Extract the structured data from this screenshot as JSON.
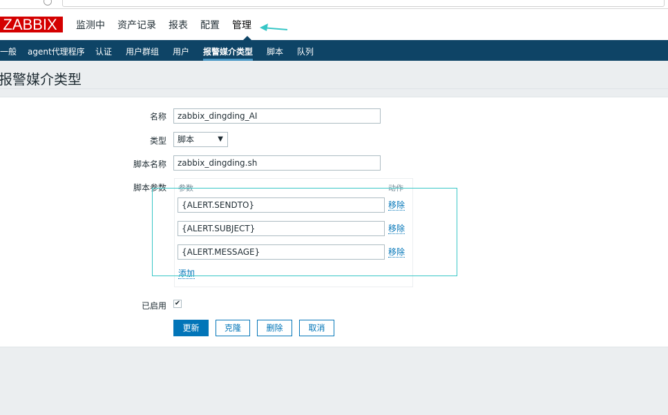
{
  "logo_text": "ZABBIX",
  "main_menu": [
    "监测中",
    "资产记录",
    "报表",
    "配置",
    "管理"
  ],
  "sub_nav": [
    "一般",
    "agent代理程序",
    "认证",
    "用户群组",
    "用户",
    "报警媒介类型",
    "脚本",
    "队列"
  ],
  "page_title": "报警媒介类型",
  "form": {
    "name_label": "名称",
    "name_value": "zabbix_dingding_AI",
    "type_label": "类型",
    "type_value": "脚本",
    "script_name_label": "脚本名称",
    "script_name_value": "zabbix_dingding.sh",
    "script_params_label": "脚本参数",
    "params_header": "参数",
    "action_header": "动作",
    "params": [
      {
        "value": "{ALERT.SENDTO}",
        "remove": "移除"
      },
      {
        "value": "{ALERT.SUBJECT}",
        "remove": "移除"
      },
      {
        "value": "{ALERT.MESSAGE}",
        "remove": "移除"
      }
    ],
    "add_label": "添加",
    "enabled_label": "已启用",
    "enabled": true
  },
  "buttons": {
    "update": "更新",
    "clone": "克隆",
    "delete": "删除",
    "cancel": "取消"
  },
  "colors": {
    "accent": "#0275b8",
    "nav": "#0e4466",
    "logo": "#d40000",
    "annotation": "#36c6c6"
  }
}
